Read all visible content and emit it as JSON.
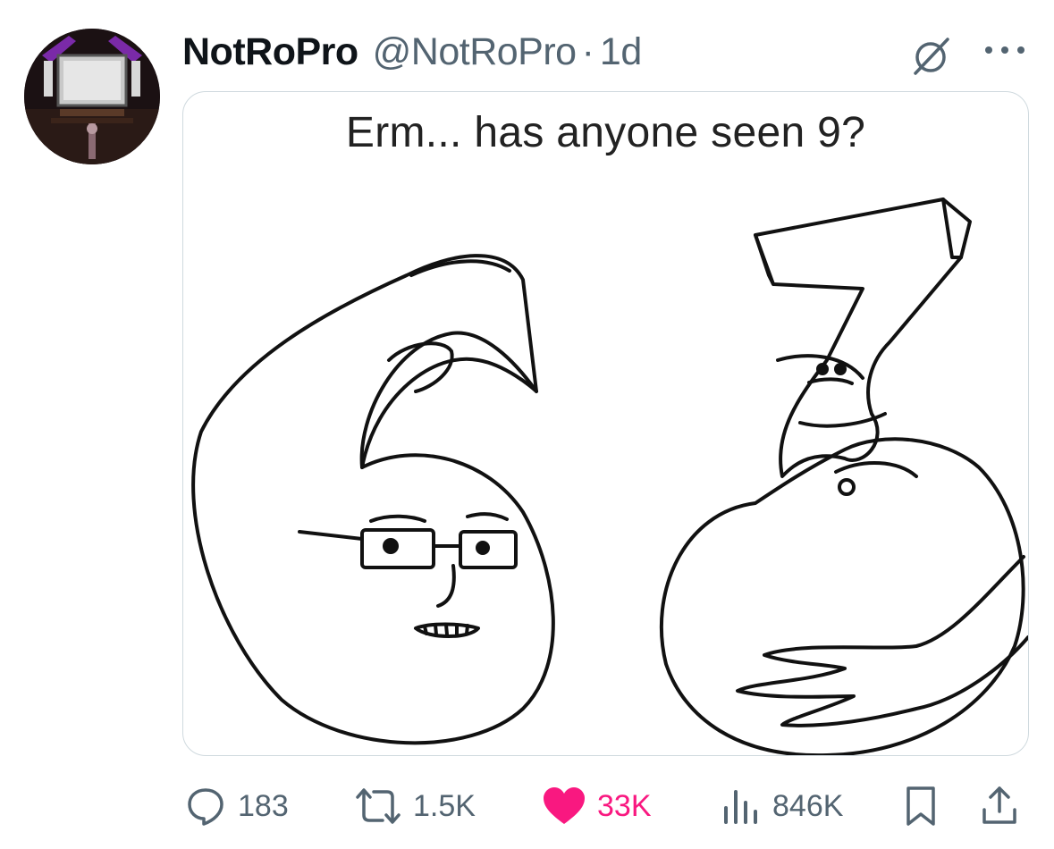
{
  "tweet": {
    "author": {
      "display_name": "NotRoPro",
      "handle": "@NotRoPro",
      "avatar_icon": "avatar-image"
    },
    "separator": "·",
    "time": "1d",
    "media": {
      "caption": "Erm... has anyone seen 9?"
    },
    "actions": {
      "replies": "183",
      "reposts": "1.5K",
      "likes": "33K",
      "views": "846K"
    }
  },
  "icons": {
    "grok": "grok-icon",
    "more": "more-icon",
    "reply": "reply-icon",
    "repost": "repost-icon",
    "like": "heart-icon",
    "views": "views-icon",
    "bookmark": "bookmark-icon",
    "share": "share-icon"
  },
  "colors": {
    "text": "#0f1419",
    "secondary": "#536471",
    "like": "#f91880",
    "border": "#cfd9de"
  }
}
